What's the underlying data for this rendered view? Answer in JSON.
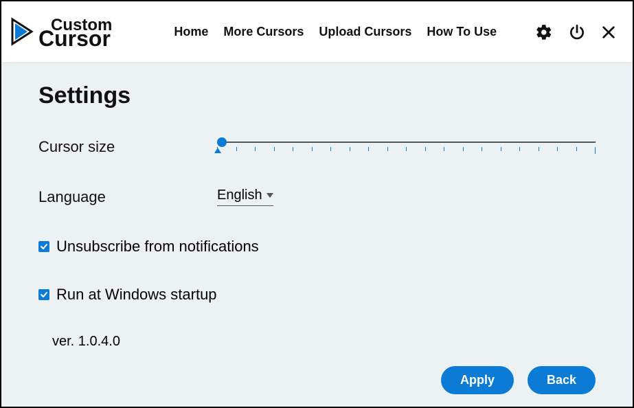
{
  "logo": {
    "top": "Custom",
    "bot": "Cursor"
  },
  "nav": {
    "home": "Home",
    "more": "More Cursors",
    "upload": "Upload Cursors",
    "howto": "How To Use"
  },
  "page_title": "Settings",
  "cursor_size": {
    "label": "Cursor size",
    "value": 0,
    "min": 0,
    "max": 20
  },
  "language": {
    "label": "Language",
    "value": "English"
  },
  "unsubscribe": {
    "label": "Unsubscribe from notifications",
    "checked": true
  },
  "startup": {
    "label": "Run at Windows startup",
    "checked": true
  },
  "version": "ver. 1.0.4.0",
  "buttons": {
    "apply": "Apply",
    "back": "Back"
  }
}
